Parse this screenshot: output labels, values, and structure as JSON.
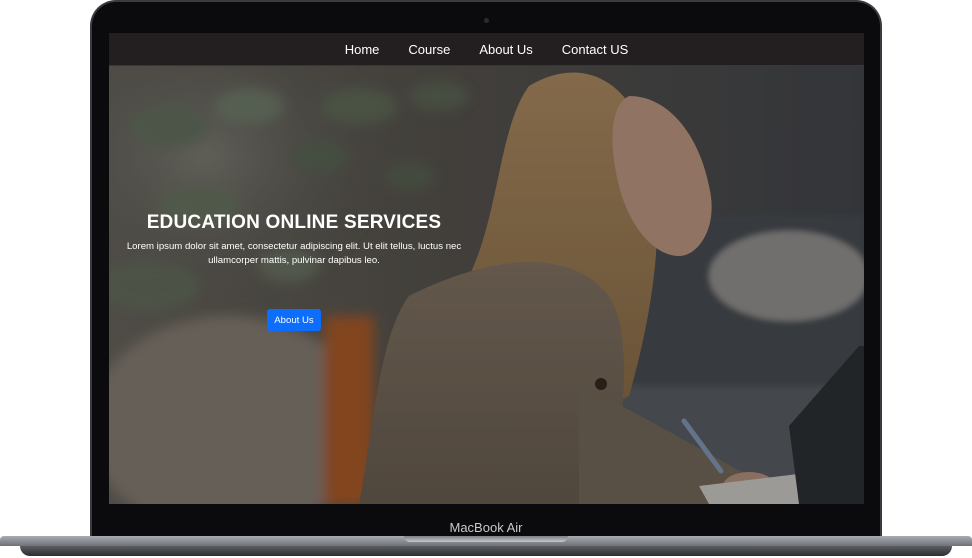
{
  "device": {
    "model_label": "MacBook Air"
  },
  "nav": {
    "items": [
      {
        "label": "Home"
      },
      {
        "label": "Course"
      },
      {
        "label": "About Us"
      },
      {
        "label": "Contact US"
      }
    ]
  },
  "hero": {
    "title": "EDUCATION ONLINE SERVICES",
    "description": "Lorem ipsum dolor sit amet, consectetur adipiscing elit. Ut elit tellus, luctus nec ullamcorper mattis, pulvinar dapibus leo.",
    "button_label": "About Us",
    "button_color": "#0d6efd",
    "image_subject": "woman-writing-at-laptop-photo"
  },
  "colors": {
    "navbar": "#231f20",
    "bezel": "#0b0b0d"
  }
}
